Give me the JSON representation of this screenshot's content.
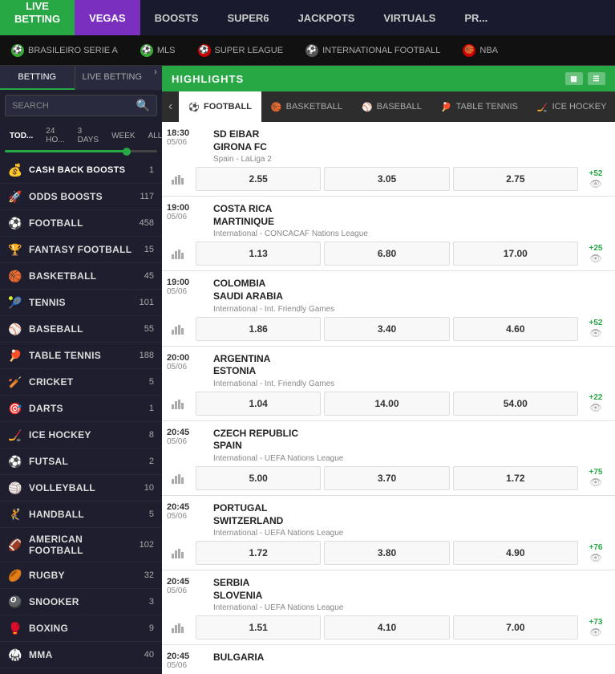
{
  "topNav": {
    "items": [
      {
        "label": "LIVE BETTING",
        "key": "live-betting",
        "class": "green"
      },
      {
        "label": "VEGAS",
        "key": "vegas",
        "class": "active"
      },
      {
        "label": "BOOSTS",
        "key": "boosts",
        "class": ""
      },
      {
        "label": "SUPER6",
        "key": "super6",
        "class": ""
      },
      {
        "label": "JACKPOTS",
        "key": "jackpots",
        "class": ""
      },
      {
        "label": "VIRTUALS",
        "key": "virtuals",
        "class": ""
      },
      {
        "label": "PR...",
        "key": "pr",
        "class": ""
      }
    ]
  },
  "sportTabs": [
    {
      "label": "BRASILEIRO SERIE A",
      "icon": "⚽"
    },
    {
      "label": "MLS",
      "icon": "⚽"
    },
    {
      "label": "SUPER LEAGUE",
      "icon": "⚽"
    },
    {
      "label": "INTERNATIONAL FOOTBALL",
      "icon": "⚽"
    },
    {
      "label": "NBA",
      "icon": "🏀"
    }
  ],
  "sidebarTabs": [
    {
      "label": "BETTING",
      "key": "betting",
      "active": true
    },
    {
      "label": "LIVE BETTING",
      "key": "live-betting",
      "active": false
    }
  ],
  "searchPlaceholder": "SEARCH",
  "timeFilters": [
    {
      "label": "TOD...",
      "active": true
    },
    {
      "label": "24 HO...",
      "active": false
    },
    {
      "label": "3 DAYS",
      "active": false
    },
    {
      "label": "WEEK",
      "active": false
    },
    {
      "label": "ALL",
      "active": false
    }
  ],
  "sidebarItems": [
    {
      "label": "CASH BACK BOOSTS",
      "count": 1,
      "icon": "💰"
    },
    {
      "label": "ODDS BOOSTS",
      "count": 117,
      "icon": "🚀"
    },
    {
      "label": "FOOTBALL",
      "count": 458,
      "icon": "⚽"
    },
    {
      "label": "FANTASY FOOTBALL",
      "count": 15,
      "icon": "🏆"
    },
    {
      "label": "BASKETBALL",
      "count": 45,
      "icon": "🏀"
    },
    {
      "label": "TENNIS",
      "count": 101,
      "icon": "🎾"
    },
    {
      "label": "BASEBALL",
      "count": 55,
      "icon": "⚾"
    },
    {
      "label": "TABLE TENNIS",
      "count": 188,
      "icon": "🏓"
    },
    {
      "label": "CRICKET",
      "count": 5,
      "icon": "🏏"
    },
    {
      "label": "DARTS",
      "count": 1,
      "icon": "🎯"
    },
    {
      "label": "ICE HOCKEY",
      "count": 8,
      "icon": "🏒"
    },
    {
      "label": "FUTSAL",
      "count": 2,
      "icon": "⚽"
    },
    {
      "label": "VOLLEYBALL",
      "count": 10,
      "icon": "🏐"
    },
    {
      "label": "HANDBALL",
      "count": 5,
      "icon": "🤾"
    },
    {
      "label": "AMERICAN FOOTBALL",
      "count": 102,
      "icon": "🏈"
    },
    {
      "label": "RUGBY",
      "count": 32,
      "icon": "🏉"
    },
    {
      "label": "SNOOKER",
      "count": 3,
      "icon": "🎱"
    },
    {
      "label": "BOXING",
      "count": 9,
      "icon": "🥊"
    },
    {
      "label": "MMA",
      "count": 40,
      "icon": "🥋"
    }
  ],
  "highlights": {
    "title": "HIGHLIGHTS"
  },
  "sportFilterTabs": [
    {
      "label": "FOOTBALL",
      "icon": "⚽",
      "active": true
    },
    {
      "label": "BASKETBALL",
      "icon": "🏀",
      "active": false
    },
    {
      "label": "BASEBALL",
      "icon": "⚾",
      "active": false
    },
    {
      "label": "TABLE TENNIS",
      "icon": "🏓",
      "active": false
    },
    {
      "label": "ICE HOCKEY",
      "icon": "🏒",
      "active": false
    }
  ],
  "matches": [
    {
      "time": "18:30",
      "date": "05/06",
      "team1": "SD EIBAR",
      "team2": "GIRONA FC",
      "league": "Spain - LaLiga 2",
      "odds": [
        "2.55",
        "3.05",
        "2.75"
      ],
      "extra": "+52"
    },
    {
      "time": "19:00",
      "date": "05/06",
      "team1": "COSTA RICA",
      "team2": "MARTINIQUE",
      "league": "International - CONCACAF Nations League",
      "odds": [
        "1.13",
        "6.80",
        "17.00"
      ],
      "extra": "+25"
    },
    {
      "time": "19:00",
      "date": "05/06",
      "team1": "COLOMBIA",
      "team2": "SAUDI ARABIA",
      "league": "International - Int. Friendly Games",
      "odds": [
        "1.86",
        "3.40",
        "4.60"
      ],
      "extra": "+52"
    },
    {
      "time": "20:00",
      "date": "05/06",
      "team1": "ARGENTINA",
      "team2": "ESTONIA",
      "league": "International - Int. Friendly Games",
      "odds": [
        "1.04",
        "14.00",
        "54.00"
      ],
      "extra": "+22"
    },
    {
      "time": "20:45",
      "date": "05/06",
      "team1": "CZECH REPUBLIC",
      "team2": "SPAIN",
      "league": "International - UEFA Nations League",
      "odds": [
        "5.00",
        "3.70",
        "1.72"
      ],
      "extra": "+75"
    },
    {
      "time": "20:45",
      "date": "05/06",
      "team1": "PORTUGAL",
      "team2": "SWITZERLAND",
      "league": "International - UEFA Nations League",
      "odds": [
        "1.72",
        "3.80",
        "4.90"
      ],
      "extra": "+76"
    },
    {
      "time": "20:45",
      "date": "05/06",
      "team1": "SERBIA",
      "team2": "SLOVENIA",
      "league": "International - UEFA Nations League",
      "odds": [
        "1.51",
        "4.10",
        "7.00"
      ],
      "extra": "+73"
    },
    {
      "time": "20:45",
      "date": "05/06",
      "team1": "BULGARIA",
      "team2": "",
      "league": "",
      "odds": [],
      "extra": ""
    }
  ]
}
